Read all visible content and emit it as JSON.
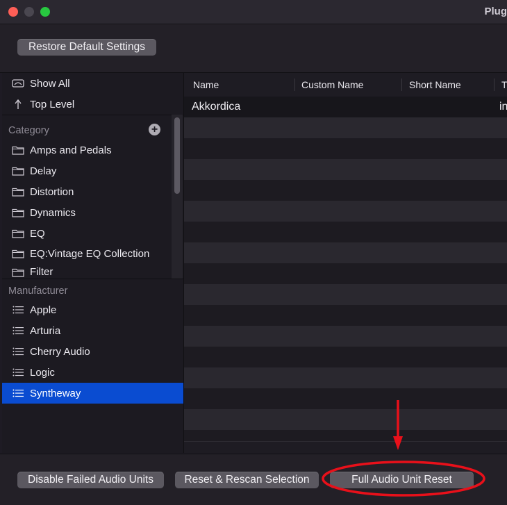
{
  "window": {
    "title": "Plug"
  },
  "toolbar": {
    "restore_label": "Restore Default Settings"
  },
  "sidebar": {
    "top_items": [
      {
        "label": "Show All",
        "icon": "show-all-icon"
      },
      {
        "label": "Top Level",
        "icon": "top-level-arrow-icon"
      }
    ],
    "category": {
      "label": "Category",
      "items": [
        {
          "label": "Amps and Pedals",
          "icon": "folder-icon"
        },
        {
          "label": "Delay",
          "icon": "folder-icon"
        },
        {
          "label": "Distortion",
          "icon": "folder-icon"
        },
        {
          "label": "Dynamics",
          "icon": "folder-icon"
        },
        {
          "label": "EQ",
          "icon": "folder-icon"
        },
        {
          "label": "EQ:Vintage EQ Collection",
          "icon": "folder-icon"
        },
        {
          "label": "Filter",
          "icon": "folder-icon"
        }
      ]
    },
    "manufacturer": {
      "label": "Manufacturer",
      "items": [
        {
          "label": "Apple",
          "icon": "list-icon"
        },
        {
          "label": "Arturia",
          "icon": "list-icon"
        },
        {
          "label": "Cherry Audio",
          "icon": "list-icon"
        },
        {
          "label": "Logic",
          "icon": "list-icon"
        },
        {
          "label": "Syntheway",
          "icon": "list-icon",
          "selected": true
        }
      ]
    }
  },
  "table": {
    "columns": [
      "Name",
      "Custom Name",
      "Short Name",
      "Ty"
    ],
    "rows": [
      [
        "Akkordica",
        "",
        "",
        "in"
      ]
    ]
  },
  "bottom": {
    "disable_label": "Disable Failed Audio Units",
    "rescan_label": "Reset & Rescan Selection",
    "full_reset_label": "Full Audio Unit Reset"
  },
  "colors": {
    "selection": "#0a4cd1",
    "annotation": "#e8101a"
  }
}
